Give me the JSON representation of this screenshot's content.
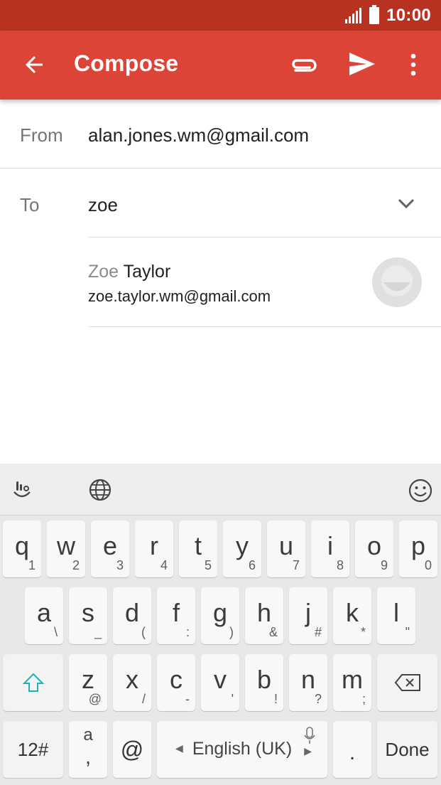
{
  "status": {
    "time": "10:00"
  },
  "app_bar": {
    "title": "Compose"
  },
  "form": {
    "from_label": "From",
    "from_value": "alan.jones.wm@gmail.com",
    "to_label": "To",
    "to_value": "zoe"
  },
  "suggestion": {
    "name_match": "Zoe",
    "name_rest": " Taylor",
    "email": "zoe.taylor.wm@gmail.com"
  },
  "keyboard": {
    "row1": [
      {
        "k": "q",
        "s": "1"
      },
      {
        "k": "w",
        "s": "2"
      },
      {
        "k": "e",
        "s": "3"
      },
      {
        "k": "r",
        "s": "4"
      },
      {
        "k": "t",
        "s": "5"
      },
      {
        "k": "y",
        "s": "6"
      },
      {
        "k": "u",
        "s": "7"
      },
      {
        "k": "i",
        "s": "8"
      },
      {
        "k": "o",
        "s": "9"
      },
      {
        "k": "p",
        "s": "0"
      }
    ],
    "row2": [
      {
        "k": "a",
        "s": "\\"
      },
      {
        "k": "s",
        "s": "_"
      },
      {
        "k": "d",
        "s": "("
      },
      {
        "k": "f",
        "s": ":"
      },
      {
        "k": "g",
        "s": ")"
      },
      {
        "k": "h",
        "s": "&"
      },
      {
        "k": "j",
        "s": "#"
      },
      {
        "k": "k",
        "s": "*"
      },
      {
        "k": "l",
        "s": "\""
      }
    ],
    "row3": [
      {
        "k": "z",
        "s": "@"
      },
      {
        "k": "x",
        "s": "/"
      },
      {
        "k": "c",
        "s": "-"
      },
      {
        "k": "v",
        "s": "'"
      },
      {
        "k": "b",
        "s": "!"
      },
      {
        "k": "n",
        "s": "?"
      },
      {
        "k": "m",
        "s": ";"
      }
    ],
    "symbols_label": "12#",
    "a_comma_top": "a",
    "a_comma_bottom": ",",
    "at_label": "@",
    "space_label": "English (UK)",
    "period_label": ".",
    "done_label": "Done"
  }
}
